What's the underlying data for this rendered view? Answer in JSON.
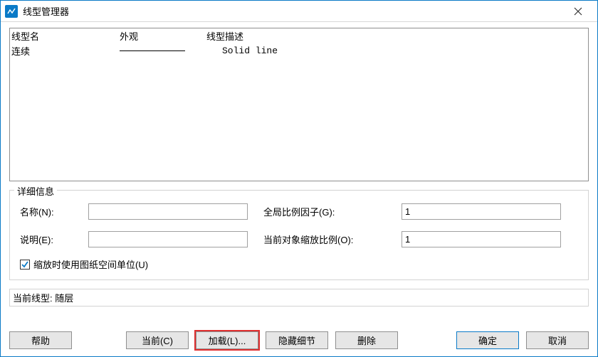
{
  "window": {
    "title": "线型管理器"
  },
  "list": {
    "headers": {
      "name": "线型名",
      "look": "外观",
      "desc": "线型描述"
    },
    "rows": [
      {
        "name": "连续",
        "desc": "Solid line"
      }
    ]
  },
  "details": {
    "legend": "详细信息",
    "name_label": "名称(N):",
    "name_value": "",
    "desc_label": "说明(E):",
    "desc_value": "",
    "global_label": "全局比例因子(G):",
    "global_value": "1",
    "current_label": "当前对象缩放比例(O):",
    "current_value": "1",
    "checkbox_label": "缩放时使用图纸空间单位(U)",
    "checkbox_checked": true
  },
  "status": {
    "text": "当前线型: 随层"
  },
  "buttons": {
    "help": "帮助",
    "current": "当前(C)",
    "load": "加载(L)...",
    "hide": "隐藏细节",
    "delete": "删除",
    "ok": "确定",
    "cancel": "取消"
  }
}
